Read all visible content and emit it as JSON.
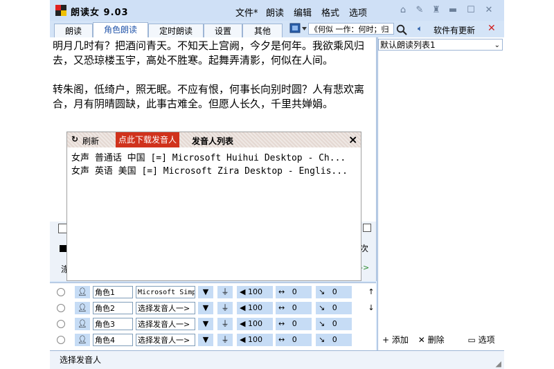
{
  "window": {
    "title": "朗读女 9.03"
  },
  "menu": [
    "文件*",
    "朗读",
    "编辑",
    "格式",
    "选项"
  ],
  "tabs": [
    "朗读",
    "角色朗读",
    "定时朗读",
    "设置",
    "其他"
  ],
  "toolbar": {
    "search_value": "《何似 一作：何时；归",
    "update_text": "软件有更新"
  },
  "editor": {
    "paragraphs": [
      "明月几时有？把酒问青天。不知天上宫阙，今夕是何年。我欲乘风归去，又恐琼楼玉宇，高处不胜寒。起舞弄清影，何似在人间。",
      "转朱阁，低绮户，照无眠。不应有恨，何事长向别时圆？人有悲欢离合，月有阴晴圆缺，此事古难全。但愿人长久，千里共婵娟。"
    ]
  },
  "popup": {
    "refresh": "刷新",
    "download": "点此下载发音人",
    "title": "发音人列表",
    "close": "×",
    "voices": [
      "女声 普通话 中国 [=] Microsoft Huihui Desktop - Ch...",
      "女声 英语 美国 [=] Microsoft Zira Desktop - Englis..."
    ]
  },
  "hidden_fragments": {
    "right_1": "次",
    "left_1": "涤",
    "right_2": "->"
  },
  "roles": [
    {
      "name": "角色1",
      "voice": "Microsoft Simp:",
      "speed": "100",
      "pitch": "0",
      "pause": "0"
    },
    {
      "name": "角色2",
      "voice": "选择发音人一>",
      "speed": "100",
      "pitch": "0",
      "pause": "0"
    },
    {
      "name": "角色3",
      "voice": "选择发音人一>",
      "speed": "100",
      "pitch": "0",
      "pause": "0"
    },
    {
      "name": "角色4",
      "voice": "选择发音人一>",
      "speed": "100",
      "pitch": "0",
      "pause": "0"
    }
  ],
  "sidebar": {
    "list_name": "默认朗读列表1",
    "add": "添加",
    "delete": "删除",
    "options": "选项"
  },
  "status": "选择发音人",
  "colors": {
    "accent": "#2255aa",
    "download_bg": "#d0321c",
    "close_red": "#d02020"
  }
}
